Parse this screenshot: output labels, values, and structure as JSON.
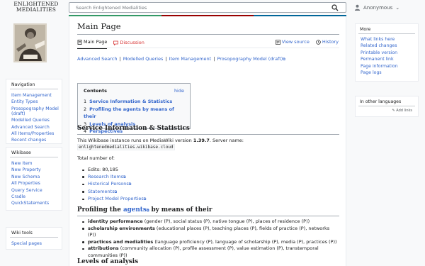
{
  "header": {
    "logo_line1": "ENLIGHTENED",
    "logo_line2": "MEDIALITIES",
    "search_placeholder": "Search Enlightened Medialities",
    "user_label": "Anonymous",
    "user_caret": "⌄",
    "flag_colors": [
      "#339966",
      "#990000",
      "#006699"
    ]
  },
  "left_sidebar": {
    "navigation": {
      "title": "Navigation",
      "items": [
        "Item Management",
        "Entity Types",
        "Prosopography Model (draft)",
        "Modelled Queries",
        "Advanced Search",
        "All Items/Properties",
        "Recent changes"
      ]
    },
    "wikibase": {
      "title": "Wikibase",
      "items": [
        "New Item",
        "New Property",
        "New Schema",
        "All Properties",
        "Query Service",
        "Cradle",
        "QuickStatements"
      ]
    },
    "wikitools": {
      "title": "Wiki tools",
      "items": [
        "Special pages"
      ]
    }
  },
  "right_sidebar": {
    "more": {
      "title": "More",
      "items": [
        "What links here",
        "Related changes",
        "Printable version",
        "Permanent link",
        "Page information",
        "Page logs"
      ]
    },
    "languages": {
      "title": "In other languages",
      "add_links": "Add links"
    }
  },
  "page": {
    "title": "Main Page",
    "tabs": {
      "main": "Main Page",
      "discussion": "Discussion",
      "view_source": "View source",
      "history": "History"
    },
    "quicklinks": [
      "Advanced Search",
      "Modelled Queries",
      "Item Management",
      "Prosopography Model (draft)"
    ],
    "toc": {
      "title": "Contents",
      "hide": "hide",
      "items": [
        {
          "num": "1",
          "label": "Service Information & Statistics"
        },
        {
          "num": "2",
          "label": "Profiling the agents by means of their"
        },
        {
          "num": "3",
          "label": "Levels of analysis"
        },
        {
          "num": "4",
          "label": "Perspectives"
        }
      ]
    },
    "section1": {
      "heading": "Service Information & Statistics",
      "runs_prefix": "This Wikibase instance runs on MediaWiki version ",
      "version": "1.39.7",
      "runs_suffix": ". Server name:",
      "server": "enlightenedmedialities.wikibase.cloud",
      "total": "Total number of:",
      "edits": "Edits: 80,185",
      "links": [
        "Research Items",
        "Historical Persons",
        "Statements",
        "Project Model Properties"
      ]
    },
    "section2": {
      "heading_pre": "Profiling the ",
      "heading_link": "agents",
      "heading_post": " by means of their",
      "items": [
        {
          "term": "identity performance",
          "desc": " (gender (P), social status (P), native tongue (P), places of residence (P))"
        },
        {
          "term": "scholarship environments",
          "desc": " (educational places (P), teaching places (P), fields of practice (P), networks (P))"
        },
        {
          "term": "practices and medialities",
          "desc": " (language proficiency (P), language of scholarship (P), media (P), practices (P))"
        },
        {
          "term": "attributions",
          "desc": " (community allocation (P), profile assessment (P), value estimation (P), transtemporal communities (P))"
        }
      ]
    },
    "section3": {
      "heading": "Levels of analysis"
    }
  }
}
